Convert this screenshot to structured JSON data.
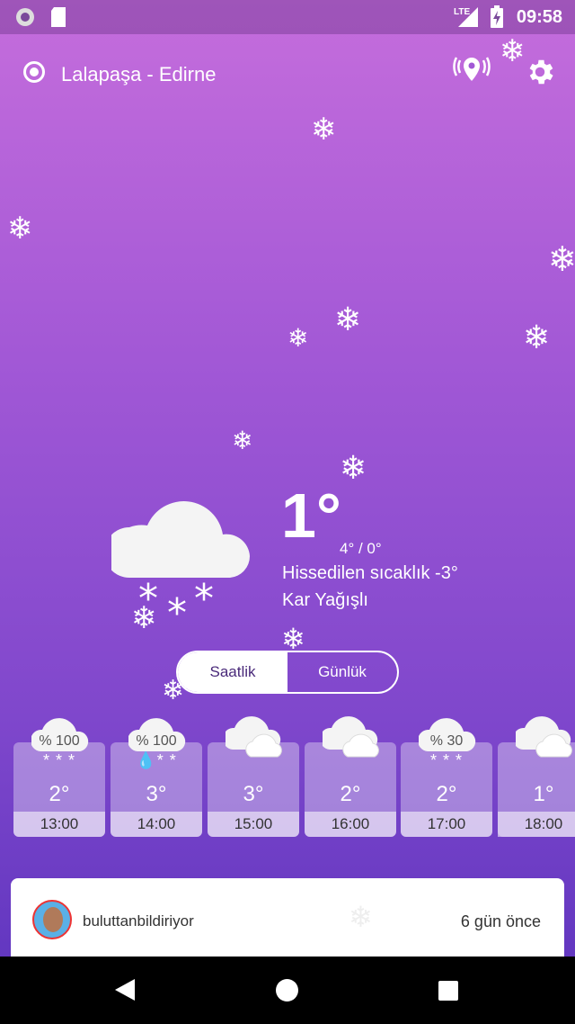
{
  "status_bar": {
    "time": "09:58",
    "network": "LTE"
  },
  "header": {
    "location": "Lalapaşa - Edirne",
    "icons": [
      "location-radio-icon",
      "location-pin-icon",
      "gear-icon"
    ]
  },
  "current": {
    "temp": "1°",
    "minmax": "4° / 0°",
    "feels_like": "Hissedilen sıcaklık -3°",
    "condition": "Kar Yağışlı",
    "icon": "cloud-snow-icon"
  },
  "toggle": {
    "hourly_label": "Saatlik",
    "daily_label": "Günlük",
    "selected": "daily"
  },
  "hourly": [
    {
      "time": "13:00",
      "temp": "2°",
      "precip": "% 100",
      "icon": "snow-cloud-icon"
    },
    {
      "time": "14:00",
      "temp": "3°",
      "precip": "% 100",
      "icon": "sleet-cloud-icon"
    },
    {
      "time": "15:00",
      "temp": "3°",
      "precip": "",
      "icon": "cloudy-icon"
    },
    {
      "time": "16:00",
      "temp": "2°",
      "precip": "",
      "icon": "cloudy-icon"
    },
    {
      "time": "17:00",
      "temp": "2°",
      "precip": "% 30",
      "icon": "snow-cloud-icon"
    },
    {
      "time": "18:00",
      "temp": "1°",
      "precip": "",
      "icon": "cloudy-icon"
    }
  ],
  "post": {
    "username": "buluttanbildiriyor",
    "time_ago": "6 gün önce"
  },
  "colors": {
    "bg_top": "#c56ddc",
    "bg_bottom": "#5b33bd",
    "toggle_text": "#4a2a7a"
  }
}
